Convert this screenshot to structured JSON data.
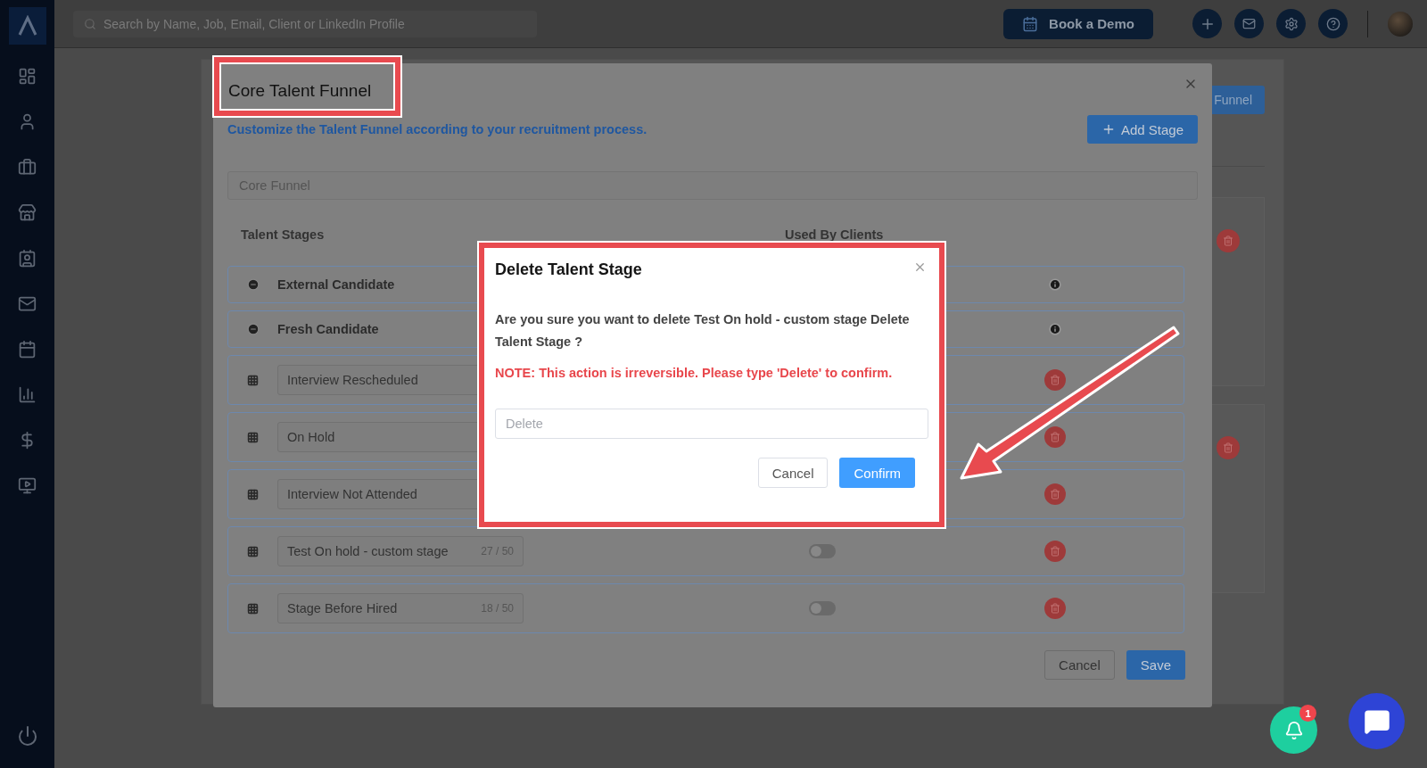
{
  "topbar": {
    "search": {
      "placeholder": "Search by Name, Job, Email, Client or LinkedIn Profile"
    },
    "book_demo": "Book a Demo"
  },
  "background": {
    "funnel_button": "Funnel"
  },
  "modal": {
    "title": "Core Talent Funnel",
    "subtitle": "Customize the Talent Funnel according to your recruitment process.",
    "add_stage": "Add Stage",
    "funnel_name": "Core Funnel",
    "columns": [
      "Talent Stages",
      "Used By Clients"
    ],
    "stages": [
      {
        "kind": "fixed",
        "name": "External Candidate"
      },
      {
        "kind": "fixed",
        "name": "Fresh Candidate"
      },
      {
        "kind": "custom",
        "name": "Interview Rescheduled"
      },
      {
        "kind": "custom",
        "name": "On Hold"
      },
      {
        "kind": "custom",
        "name": "Interview Not Attended"
      },
      {
        "kind": "custom",
        "name": "Test On hold - custom stage",
        "counter": "27 / 50",
        "used_by_clients": false
      },
      {
        "kind": "custom",
        "name": "Stage Before Hired",
        "counter": "18 / 50",
        "used_by_clients": false
      }
    ],
    "buttons": [
      "Cancel",
      "Save"
    ]
  },
  "dialog": {
    "title": "Delete Talent Stage",
    "message": "Are you sure you want to delete Test On hold - custom stage Delete Talent Stage ?",
    "note": "NOTE: This action is irreversible. Please type 'Delete' to confirm.",
    "input": {
      "placeholder": "Delete"
    },
    "buttons": [
      "Cancel",
      "Confirm"
    ]
  },
  "notifications": {
    "count": "1"
  }
}
